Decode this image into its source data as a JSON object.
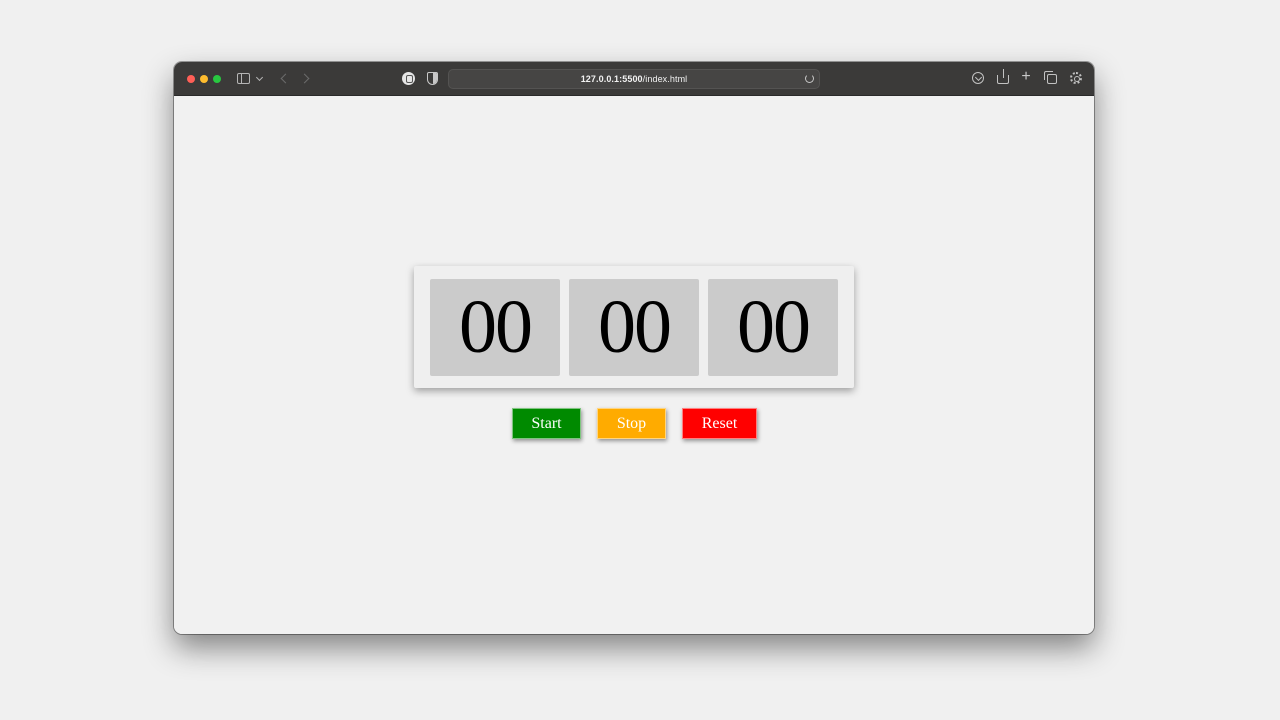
{
  "browser": {
    "url_host": "127.0.0.1:5500",
    "url_path": "/index.html"
  },
  "stopwatch": {
    "hours": "00",
    "minutes": "00",
    "seconds": "00"
  },
  "buttons": {
    "start_label": "Start",
    "stop_label": "Stop",
    "reset_label": "Reset"
  },
  "colors": {
    "start": "#008a00",
    "stop": "#ffab00",
    "reset": "#ff0000",
    "digit_bg": "#cbcbcb",
    "toolbar_bg": "#3b3a39"
  },
  "icons": {
    "window_controls": [
      "close-light",
      "minimize-light",
      "zoom-light"
    ],
    "toolbar_left": [
      "sidebar-icon",
      "chevron-down-icon",
      "back-icon",
      "forward-icon"
    ],
    "address_area": [
      "privacy-report-icon",
      "shield-icon",
      "reload-icon"
    ],
    "toolbar_right": [
      "download-icon",
      "share-icon",
      "new-tab-icon",
      "tab-overview-icon",
      "settings-icon"
    ]
  }
}
